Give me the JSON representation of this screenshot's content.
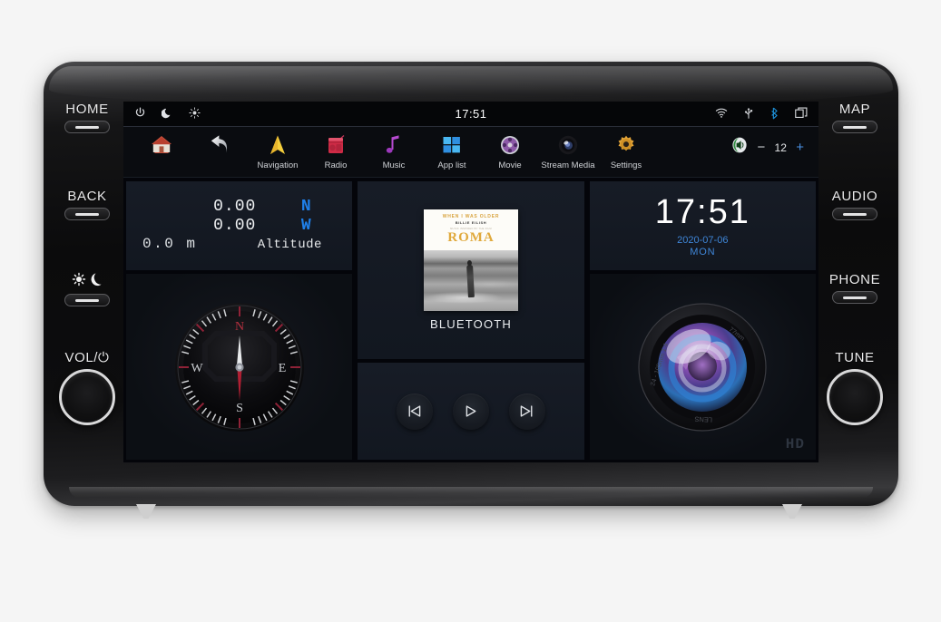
{
  "device": {
    "left_controls": [
      {
        "label": "HOME",
        "type": "key",
        "name": "home"
      },
      {
        "label": "BACK",
        "type": "key",
        "name": "back"
      },
      {
        "label": "☀ ☽",
        "type": "key",
        "name": "day-night"
      },
      {
        "label": "VOL/⏻",
        "type": "knob",
        "name": "volume-power"
      }
    ],
    "right_controls": [
      {
        "label": "MAP",
        "type": "key",
        "name": "map"
      },
      {
        "label": "AUDIO",
        "type": "key",
        "name": "audio"
      },
      {
        "label": "PHONE",
        "type": "key",
        "name": "phone"
      },
      {
        "label": "TUNE",
        "type": "knob",
        "name": "tune"
      }
    ]
  },
  "statusbar": {
    "time": "17:51",
    "left_icons": [
      "power-icon",
      "night-mode-icon",
      "brightness-icon"
    ],
    "right_icons": [
      "wifi-icon",
      "usb-icon",
      "bluetooth-icon",
      "recents-icon"
    ]
  },
  "dock": {
    "apps": [
      {
        "label": "",
        "icon": "home-icon"
      },
      {
        "label": "",
        "icon": "back-arrow-icon"
      },
      {
        "label": "Navigation",
        "icon": "navigation-icon"
      },
      {
        "label": "Radio",
        "icon": "radio-icon"
      },
      {
        "label": "Music",
        "icon": "music-note-icon"
      },
      {
        "label": "App list",
        "icon": "app-grid-icon"
      },
      {
        "label": "Movie",
        "icon": "film-reel-icon"
      },
      {
        "label": "Stream Media",
        "icon": "camera-lens-icon"
      },
      {
        "label": "Settings",
        "icon": "gear-icon"
      }
    ],
    "volume": {
      "icon": "speaker-icon",
      "minus": "−",
      "value": "12",
      "plus": "+"
    }
  },
  "gps": {
    "latitude": "0.00",
    "lat_dir": "N",
    "longitude": "0.00",
    "lon_dir": "W",
    "altitude": "0.0 m",
    "altitude_label": "Altitude",
    "compass": {
      "north": "N",
      "east": "E",
      "south": "S",
      "west": "W",
      "needle_color": "#c8102e"
    }
  },
  "media": {
    "album": {
      "line1": "WHEN I WAS OLDER",
      "line2": "BILLIE EILISH",
      "line3": "MUSIC INSPIRED BY THE FILM",
      "title": "ROMA"
    },
    "source": "BLUETOOTH",
    "controls": [
      {
        "name": "previous-button",
        "glyph": "⏮"
      },
      {
        "name": "play-button",
        "glyph": "▷"
      },
      {
        "name": "next-button",
        "glyph": "⏭"
      }
    ]
  },
  "clock": {
    "time": "17:51",
    "date": "2020-07-06",
    "weekday": "MON"
  },
  "dvr": {
    "badge": "HD",
    "lens_text_top": "77mm",
    "lens_text_left": "24 - 105mm 1:4",
    "lens_text_bottom": "LENS"
  },
  "colors": {
    "accent_blue": "#1f7fe8",
    "date_blue": "#3f86d8",
    "compass_red": "#c8102e",
    "panel_bg": "#171c26"
  }
}
